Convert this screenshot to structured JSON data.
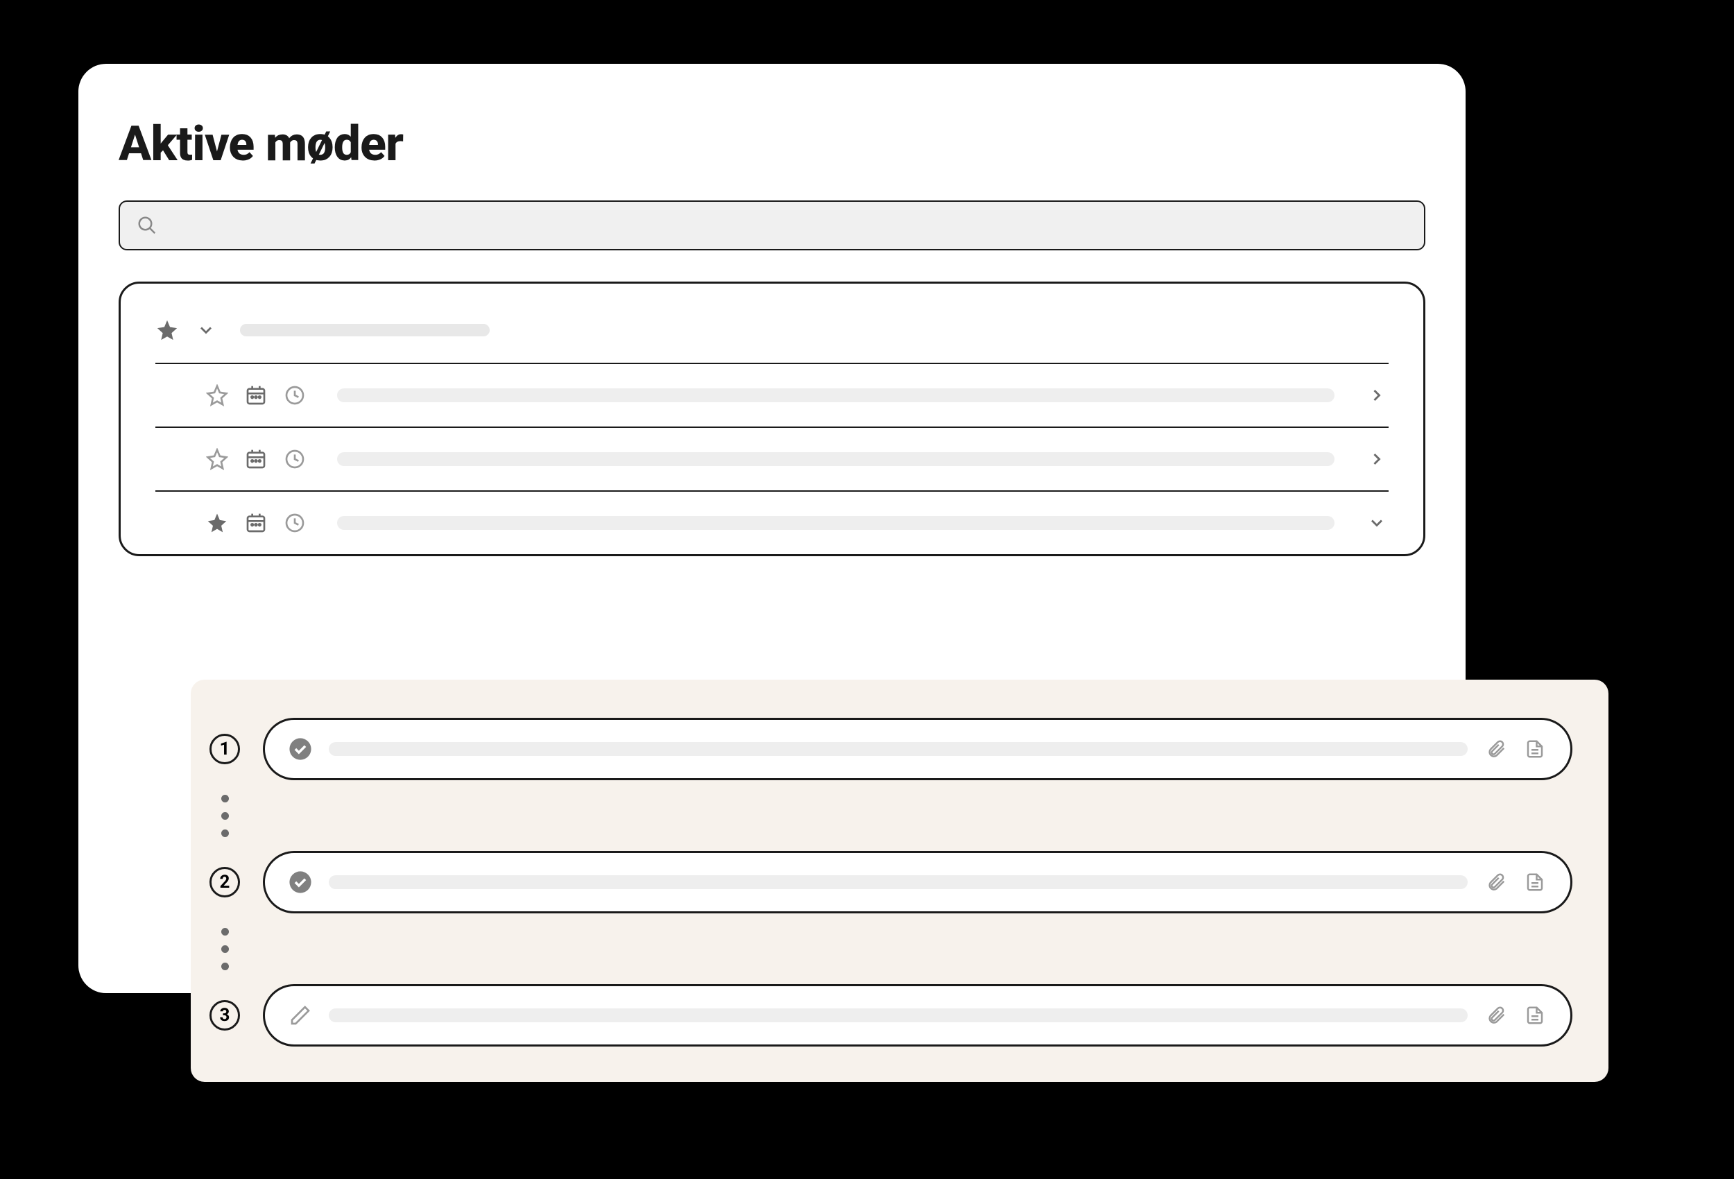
{
  "page": {
    "title": "Aktive møder"
  },
  "search": {
    "placeholder": ""
  },
  "group": {
    "starred": true,
    "expanded": true
  },
  "meetings": [
    {
      "starred": false,
      "expanded": false,
      "chevron": "right"
    },
    {
      "starred": false,
      "expanded": false,
      "chevron": "right"
    },
    {
      "starred": true,
      "expanded": true,
      "chevron": "down"
    }
  ],
  "agenda": {
    "items": [
      {
        "step": "1",
        "status": "done"
      },
      {
        "step": "2",
        "status": "done"
      },
      {
        "step": "3",
        "status": "editing"
      }
    ]
  },
  "icons": {
    "star_filled": "star-filled-icon",
    "star_outline": "star-outline-icon",
    "calendar": "calendar-icon",
    "clock": "clock-icon",
    "chevron_down": "chevron-down-icon",
    "chevron_right": "chevron-right-icon",
    "search": "search-icon",
    "check_circle": "check-circle-icon",
    "pencil": "pencil-icon",
    "paperclip": "paperclip-icon",
    "document": "document-icon"
  }
}
